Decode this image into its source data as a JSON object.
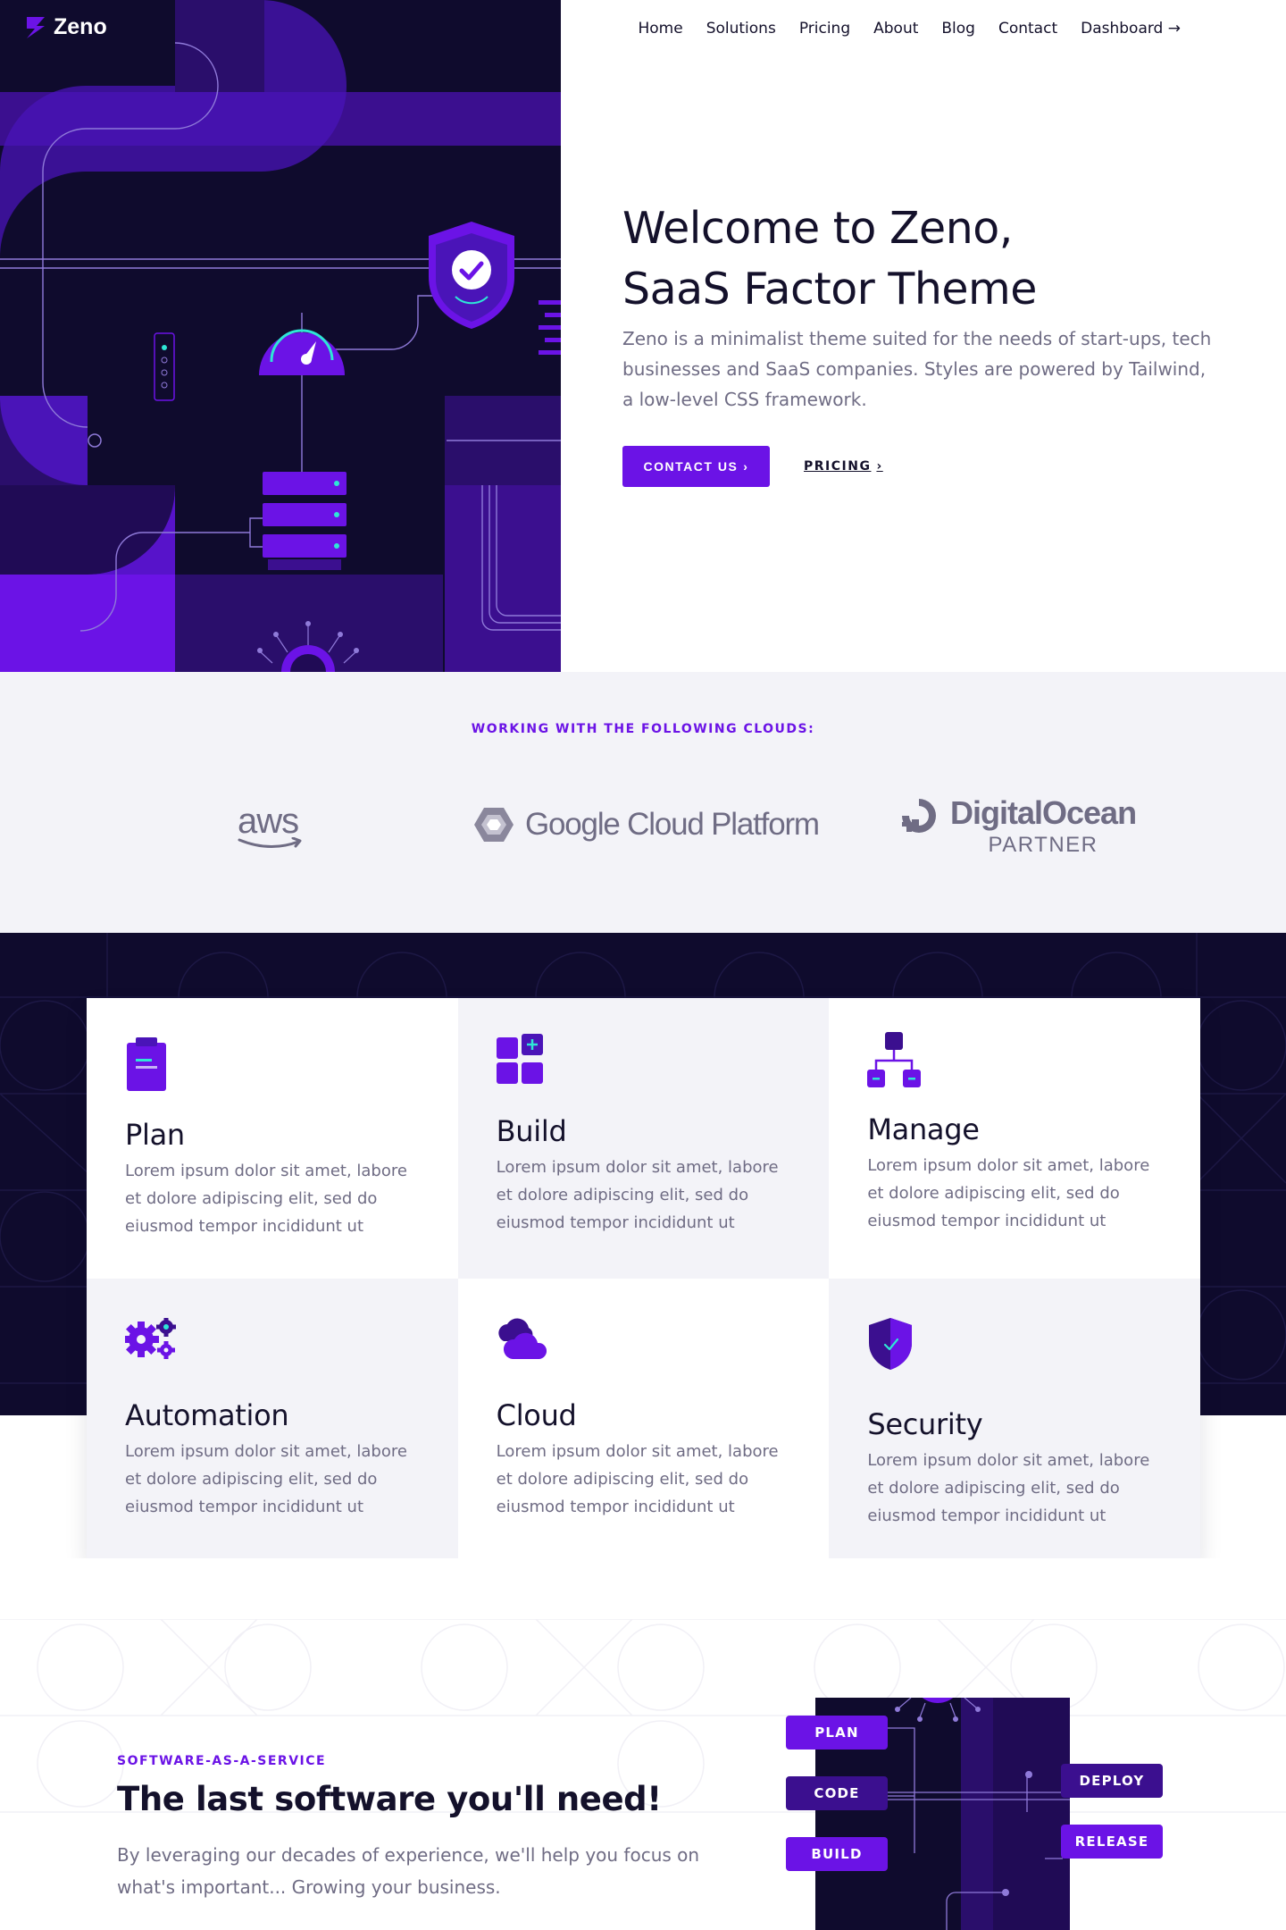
{
  "header": {
    "logo_text": "Zeno",
    "nav": [
      "Home",
      "Solutions",
      "Pricing",
      "About",
      "Blog",
      "Contact",
      "Dashboard →"
    ]
  },
  "hero": {
    "title_line1": "Welcome to Zeno,",
    "title_line2": "SaaS Factor Theme",
    "subtitle": "Zeno is a minimalist theme suited for the needs of start-ups, tech businesses and SaaS companies. Styles are powered by Tailwind, a low-level CSS framework.",
    "cta_primary": "CONTACT US",
    "cta_secondary": "PRICING"
  },
  "clouds": {
    "heading": "WORKING WITH THE FOLLOWING CLOUDS:",
    "aws": "aws",
    "gcp": "Google Cloud Platform",
    "digitalocean": "DigitalOcean",
    "digitalocean_sub": "PARTNER"
  },
  "features": [
    {
      "title": "Plan",
      "text": "Lorem ipsum dolor sit amet, labore et dolore adipiscing elit, sed do eiusmod tempor incididunt ut",
      "icon": "clipboard-icon"
    },
    {
      "title": "Build",
      "text": "Lorem ipsum dolor sit amet, labore et dolore adipiscing elit, sed do eiusmod tempor incididunt ut",
      "icon": "blocks-icon"
    },
    {
      "title": "Manage",
      "text": "Lorem ipsum dolor sit amet, labore et dolore adipiscing elit, sed do eiusmod tempor incididunt ut",
      "icon": "hierarchy-icon"
    },
    {
      "title": "Automation",
      "text": "Lorem ipsum dolor sit amet, labore et dolore adipiscing elit, sed do eiusmod tempor incididunt ut",
      "icon": "gears-icon"
    },
    {
      "title": "Cloud",
      "text": "Lorem ipsum dolor sit amet, labore et dolore adipiscing elit, sed do eiusmod tempor incididunt ut",
      "icon": "cloud-icon"
    },
    {
      "title": "Security",
      "text": "Lorem ipsum dolor sit amet, labore et dolore adipiscing elit, sed do eiusmod tempor incididunt ut",
      "icon": "shield-icon"
    }
  ],
  "saas": {
    "eyebrow": "SOFTWARE-AS-A-SERVICE",
    "title": "The last software you'll need!",
    "text": "By leveraging our decades of experience, we'll help you focus on what's important... Growing your business.",
    "pills": [
      "PLAN",
      "CODE",
      "BUILD",
      "DEPLOY",
      "RELEASE"
    ]
  },
  "colors": {
    "accent": "#6b13e6",
    "dark": "#0f0b2d",
    "text": "#14112b",
    "muted": "#6f6c84",
    "light_bg": "#f3f3f8",
    "teal": "#2ee6d6"
  }
}
